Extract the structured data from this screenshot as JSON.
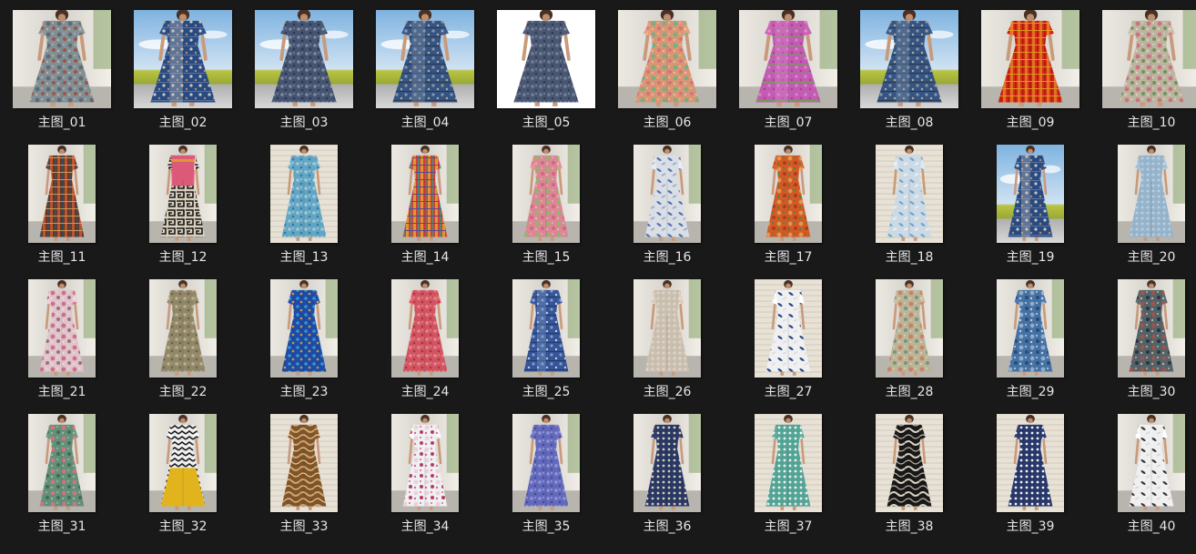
{
  "folder": {
    "items": [
      {
        "name": "主图_01",
        "bg": "scene",
        "dress": [
          "#8a9aa0",
          "#c8bfb3",
          "#6b6f78",
          "#a85a4a"
        ],
        "pattern": "floral"
      },
      {
        "name": "主图_02",
        "bg": "sky",
        "dress": [
          "#2c4f8a",
          "#d8d2c8",
          "#5c7bb0",
          "#b89a7a"
        ],
        "pattern": "panel"
      },
      {
        "name": "主图_03",
        "bg": "sky",
        "dress": [
          "#4a5a7a",
          "#8a93a6",
          "#2d3a55",
          "#a8a8b0"
        ],
        "pattern": "paisley"
      },
      {
        "name": "主图_04",
        "bg": "sky",
        "dress": [
          "#3a5a8a",
          "#8fa0b8",
          "#2c3e5c",
          "#c2b6a4"
        ],
        "pattern": "panel"
      },
      {
        "name": "主图_05",
        "bg": "white",
        "dress": [
          "#4f5d7a",
          "#7b879e",
          "#334060",
          "#a9b0c0"
        ],
        "pattern": "paisley"
      },
      {
        "name": "主图_06",
        "bg": "scene",
        "dress": [
          "#e8a07a",
          "#f0c8b0",
          "#7fb890",
          "#e07a8a"
        ],
        "pattern": "floral"
      },
      {
        "name": "主图_07",
        "bg": "scene",
        "dress": [
          "#d060c0",
          "#e890d8",
          "#70b050",
          "#c04090"
        ],
        "pattern": "panel"
      },
      {
        "name": "主图_08",
        "bg": "sky",
        "dress": [
          "#3a5a8a",
          "#8fa0b8",
          "#2c3e5c",
          "#c2b6a4"
        ],
        "pattern": "panel"
      },
      {
        "name": "主图_09",
        "bg": "scene",
        "dress": [
          "#e03018",
          "#f07828",
          "#c01810",
          "#f0a020"
        ],
        "pattern": "stripes"
      },
      {
        "name": "主图_10",
        "bg": "scene",
        "dress": [
          "#c8c0a8",
          "#e8e0cc",
          "#d87a8a",
          "#7a9a6a"
        ],
        "pattern": "floral"
      },
      {
        "name": "主图_11",
        "bg": "scene",
        "dress": [
          "#6a3a2a",
          "#c85a30",
          "#3a5a6a",
          "#d8a060"
        ],
        "pattern": "stripes"
      },
      {
        "name": "主图_12",
        "bg": "scene",
        "dress": [
          "#e86080",
          "#f0a040",
          "#1a1a1a",
          "#e8dcc8"
        ],
        "pattern": "maze"
      },
      {
        "name": "主图_13",
        "bg": "wall",
        "dress": [
          "#6ab0d0",
          "#a8d8e8",
          "#3a80b0",
          "#e8f0f0"
        ],
        "pattern": "paisley"
      },
      {
        "name": "主图_14",
        "bg": "scene",
        "dress": [
          "#e04040",
          "#f0a030",
          "#40a080",
          "#6050a0"
        ],
        "pattern": "stripes"
      },
      {
        "name": "主图_15",
        "bg": "scene",
        "dress": [
          "#e890a0",
          "#f0c0c8",
          "#a0c070",
          "#e07080"
        ],
        "pattern": "floral"
      },
      {
        "name": "主图_16",
        "bg": "scene",
        "dress": [
          "#e8ecf4",
          "#5a7ab8",
          "#a8b8d8",
          "#ffffff"
        ],
        "pattern": "leaf"
      },
      {
        "name": "主图_17",
        "bg": "scene",
        "dress": [
          "#e06028",
          "#40905a",
          "#f0a050",
          "#b84020"
        ],
        "pattern": "floral"
      },
      {
        "name": "主图_18",
        "bg": "wall",
        "dress": [
          "#d8e8f4",
          "#7ab0d8",
          "#ffffff",
          "#5a90c0"
        ],
        "pattern": "leaf"
      },
      {
        "name": "主图_19",
        "bg": "sky",
        "dress": [
          "#2c4f8a",
          "#d8d2c8",
          "#5c7bb0",
          "#b89a7a"
        ],
        "pattern": "panel"
      },
      {
        "name": "主图_20",
        "bg": "scene",
        "dress": [
          "#a0c0d8",
          "#c8dcec",
          "#7aa0c0",
          "#e0ecf4"
        ],
        "pattern": "dots"
      },
      {
        "name": "主图_21",
        "bg": "scene",
        "dress": [
          "#f0d0d8",
          "#f8e8ec",
          "#d87a90",
          "#a07a8a"
        ],
        "pattern": "floral"
      },
      {
        "name": "主图_22",
        "bg": "scene",
        "dress": [
          "#9a9070",
          "#c8bc98",
          "#6a6a50",
          "#d8a070"
        ],
        "pattern": "paisley"
      },
      {
        "name": "主图_23",
        "bg": "scene",
        "dress": [
          "#2050b0",
          "#3aa0d8",
          "#e0a040",
          "#104080"
        ],
        "pattern": "paisley"
      },
      {
        "name": "主图_24",
        "bg": "scene",
        "dress": [
          "#e05a6a",
          "#f0909a",
          "#c03040",
          "#e8c080"
        ],
        "pattern": "paisley"
      },
      {
        "name": "主图_25",
        "bg": "scene",
        "dress": [
          "#3a5aa0",
          "#8aa8d8",
          "#20407a",
          "#d0dcf0"
        ],
        "pattern": "panel"
      },
      {
        "name": "主图_26",
        "bg": "scene",
        "dress": [
          "#d8ccbc",
          "#ece4d8",
          "#b0a090",
          "#f8f4ec"
        ],
        "pattern": "dots"
      },
      {
        "name": "主图_27",
        "bg": "wall",
        "dress": [
          "#ffffff",
          "#2c4a90",
          "#e8ecf4",
          "#1a3070"
        ],
        "pattern": "leaf"
      },
      {
        "name": "主图_28",
        "bg": "scene",
        "dress": [
          "#c8c0a0",
          "#e8dcc0",
          "#d88a70",
          "#7aa08a"
        ],
        "pattern": "floral"
      },
      {
        "name": "主图_29",
        "bg": "scene",
        "dress": [
          "#4a7ab0",
          "#d8e0e8",
          "#9ab8d8",
          "#2c5080"
        ],
        "pattern": "floral"
      },
      {
        "name": "主图_30",
        "bg": "scene",
        "dress": [
          "#5a6a70",
          "#c8c0b0",
          "#a85a50",
          "#2c3a40"
        ],
        "pattern": "floral"
      },
      {
        "name": "主图_31",
        "bg": "scene",
        "dress": [
          "#6a9a80",
          "#a0c8a8",
          "#e07a8a",
          "#4a7060"
        ],
        "pattern": "floral"
      },
      {
        "name": "主图_32",
        "bg": "scene",
        "dress": [
          "#1a1a1a",
          "#ffffff",
          "#f0c020",
          "#e8b010"
        ],
        "pattern": "chevron"
      },
      {
        "name": "主图_33",
        "bg": "wall",
        "dress": [
          "#8a5a28",
          "#d8b080",
          "#6a4018",
          "#f0d8b0"
        ],
        "pattern": "waves"
      },
      {
        "name": "主图_34",
        "bg": "scene",
        "dress": [
          "#ffffff",
          "#e070a0",
          "#f8e0ec",
          "#c04070"
        ],
        "pattern": "floral"
      },
      {
        "name": "主图_35",
        "bg": "scene",
        "dress": [
          "#6a70c8",
          "#9aa0e0",
          "#4a50a0",
          "#c8ccf0"
        ],
        "pattern": "paisley"
      },
      {
        "name": "主图_36",
        "bg": "scene",
        "dress": [
          "#2a3a6a",
          "#e0d8c0",
          "#4a5a8a",
          "#f0c060"
        ],
        "pattern": "dots"
      },
      {
        "name": "主图_37",
        "bg": "wall",
        "dress": [
          "#5ab0a0",
          "#ffffff",
          "#3a9080",
          "#a0d8cc"
        ],
        "pattern": "dots"
      },
      {
        "name": "主图_38",
        "bg": "wall",
        "dress": [
          "#1a1a1a",
          "#e8e0d0",
          "#3a3a3a",
          "#c8c0b0"
        ],
        "pattern": "waves"
      },
      {
        "name": "主图_39",
        "bg": "wall",
        "dress": [
          "#2a3a70",
          "#ffffff",
          "#4a5a90",
          "#d8dcec"
        ],
        "pattern": "dots"
      },
      {
        "name": "主图_40",
        "bg": "scene",
        "dress": [
          "#ffffff",
          "#3a3a3a",
          "#e8e8e8",
          "#5a5a5a"
        ],
        "pattern": "leaf"
      }
    ]
  }
}
